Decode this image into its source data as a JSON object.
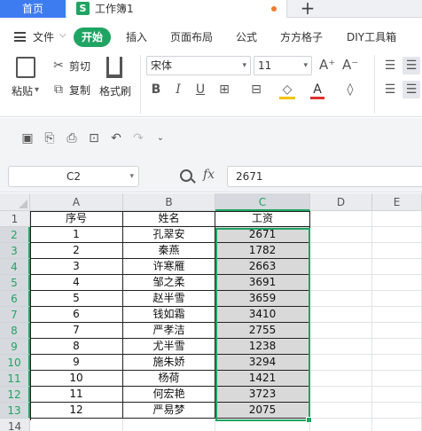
{
  "tabs": {
    "home": "首页",
    "doc_logo": "S",
    "doc_title": "工作簿1",
    "new_tab": "+"
  },
  "menu": {
    "file": "文件",
    "items": [
      "开始",
      "插入",
      "页面布局",
      "公式",
      "方方格子",
      "DIY工具箱"
    ]
  },
  "ribbon": {
    "paste": "粘贴",
    "cut": "剪切",
    "copy": "复制",
    "format_painter": "格式刷",
    "font_name": "宋体",
    "font_size": "11"
  },
  "formula_bar": {
    "cell_ref": "C2",
    "fx": "fx",
    "value": "2671"
  },
  "grid": {
    "columns": [
      "A",
      "B",
      "C",
      "D",
      "E"
    ],
    "rows": [
      "1",
      "2",
      "3",
      "4",
      "5",
      "6",
      "7",
      "8",
      "9",
      "10",
      "11",
      "12",
      "13",
      "14"
    ],
    "header": [
      "序号",
      "姓名",
      "工资"
    ],
    "data": [
      [
        "1",
        "孔翠安",
        "2671"
      ],
      [
        "2",
        "秦燕",
        "1782"
      ],
      [
        "3",
        "许寒雁",
        "2663"
      ],
      [
        "4",
        "邹之柔",
        "3691"
      ],
      [
        "5",
        "赵半雪",
        "3659"
      ],
      [
        "6",
        "钱如霜",
        "3410"
      ],
      [
        "7",
        "严孝洁",
        "2755"
      ],
      [
        "8",
        "尤半雪",
        "1238"
      ],
      [
        "9",
        "施朱娇",
        "3294"
      ],
      [
        "10",
        "杨荷",
        "1421"
      ],
      [
        "11",
        "何宏艳",
        "3723"
      ],
      [
        "12",
        "严易梦",
        "2075"
      ]
    ]
  },
  "colors": {
    "accent_green": "#1fa463",
    "home_tab_blue": "#3d7cf0",
    "selected_fill": "#d9d9d9"
  }
}
